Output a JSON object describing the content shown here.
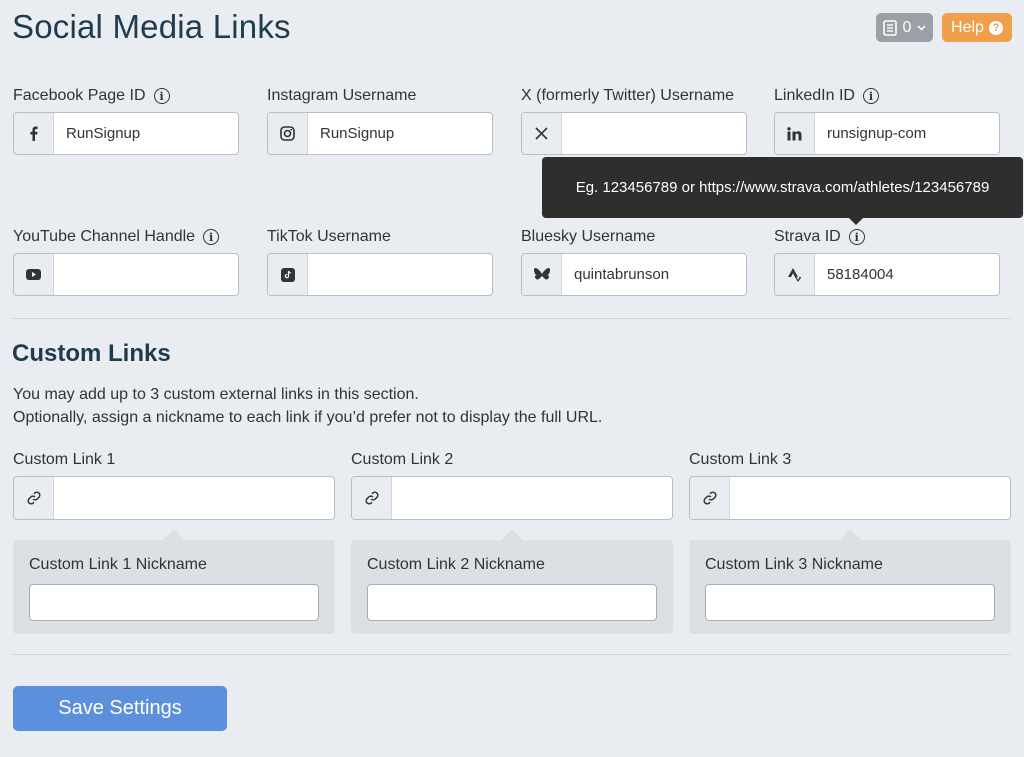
{
  "page": {
    "title": "Social Media Links"
  },
  "top": {
    "counter": "0",
    "help_label": "Help"
  },
  "social_fields": [
    {
      "label": "Facebook Page ID",
      "icon": "facebook-icon",
      "value": "RunSignup",
      "has_info": true
    },
    {
      "label": "Instagram Username",
      "icon": "instagram-icon",
      "value": "RunSignup",
      "has_info": false
    },
    {
      "label": "X (formerly Twitter) Username",
      "icon": "x-icon",
      "value": "",
      "has_info": false
    },
    {
      "label": "LinkedIn ID",
      "icon": "linkedin-icon",
      "value": "runsignup-com",
      "has_info": true
    },
    {
      "label": "YouTube Channel Handle",
      "icon": "youtube-icon",
      "value": "",
      "has_info": true
    },
    {
      "label": "TikTok Username",
      "icon": "tiktok-icon",
      "value": "",
      "has_info": false
    },
    {
      "label": "Bluesky Username",
      "icon": "bluesky-icon",
      "value": "quintabrunson",
      "has_info": false
    },
    {
      "label": "Strava ID",
      "icon": "strava-icon",
      "value": "58184004",
      "has_info": true
    }
  ],
  "tooltip": {
    "text": "Eg. 123456789 or https://www.strava.com/athletes/123456789"
  },
  "custom": {
    "title": "Custom Links",
    "description_line1": "You may add up to 3 custom external links in this section.",
    "description_line2": "Optionally, assign a nickname to each link if you’d prefer not to display the full URL.",
    "links": [
      {
        "label": "Custom Link 1",
        "value": "",
        "nickname_label": "Custom Link 1 Nickname",
        "nickname_value": ""
      },
      {
        "label": "Custom Link 2",
        "value": "",
        "nickname_label": "Custom Link 2 Nickname",
        "nickname_value": ""
      },
      {
        "label": "Custom Link 3",
        "value": "",
        "nickname_label": "Custom Link 3 Nickname",
        "nickname_value": ""
      }
    ]
  },
  "save": {
    "label": "Save Settings"
  },
  "colors": {
    "accent": "#5c8fdc",
    "help": "#f0a04b",
    "title": "#1f3b4d",
    "tooltip_bg": "#2e2e2e"
  }
}
